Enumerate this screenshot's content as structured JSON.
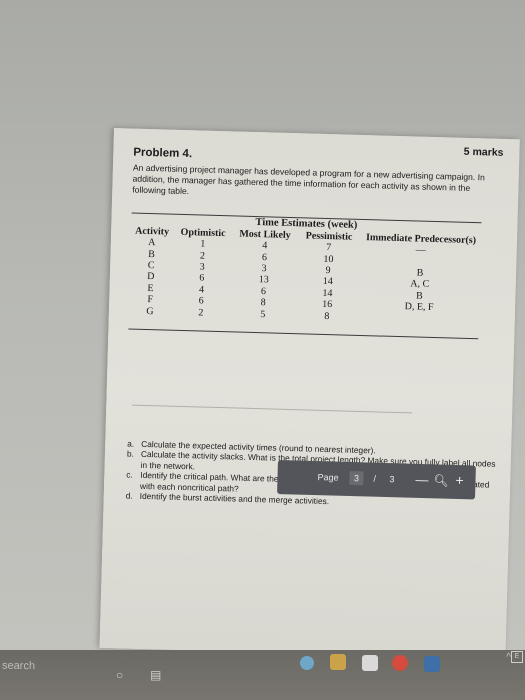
{
  "document": {
    "problem_title": "Problem 4.",
    "marks": "5 marks",
    "intro": "An advertising project manager has developed a program for a new advertising campaign. In addition, the manager has gathered the time information for each activity as shown in the following table.",
    "table": {
      "group_header": "Time Estimates (week)",
      "columns": [
        "Activity",
        "Optimistic",
        "Most Likely",
        "Pessimistic",
        "Immediate Predecessor(s)"
      ],
      "rows": [
        [
          "A",
          "1",
          "4",
          "7",
          "—"
        ],
        [
          "B",
          "2",
          "6",
          "10",
          ""
        ],
        [
          "C",
          "3",
          "3",
          "9",
          "B"
        ],
        [
          "D",
          "6",
          "13",
          "14",
          "A, C"
        ],
        [
          "E",
          "4",
          "6",
          "14",
          "B"
        ],
        [
          "F",
          "6",
          "8",
          "16",
          "D, E, F"
        ],
        [
          "G",
          "2",
          "5",
          "8",
          ""
        ]
      ]
    },
    "questions": [
      {
        "letter": "a.",
        "text": "Calculate the expected activity times (round to nearest integer)."
      },
      {
        "letter": "b.",
        "text": "Calculate the activity slacks. What is the total project length? Make sure you fully label all nodes in the network."
      },
      {
        "letter": "c.",
        "text": "Identify the critical path. What are the alternative paths and how much slack time is associated with each noncritical path?"
      },
      {
        "letter": "d.",
        "text": "Identify the burst activities and the merge activities."
      }
    ]
  },
  "pager": {
    "label": "Page",
    "current": "3",
    "separator": "/",
    "total": "3",
    "minus": "—",
    "zoom_icon": "zoom-icon",
    "plus": "+"
  },
  "taskbar": {
    "search_text": "search",
    "icons": [
      "cortana-circle-icon",
      "task-view-icon",
      "edge-icon",
      "file-explorer-icon",
      "store-icon",
      "chrome-icon",
      "mail-icon"
    ],
    "tray_chevron": "^",
    "tray_box": "E"
  }
}
